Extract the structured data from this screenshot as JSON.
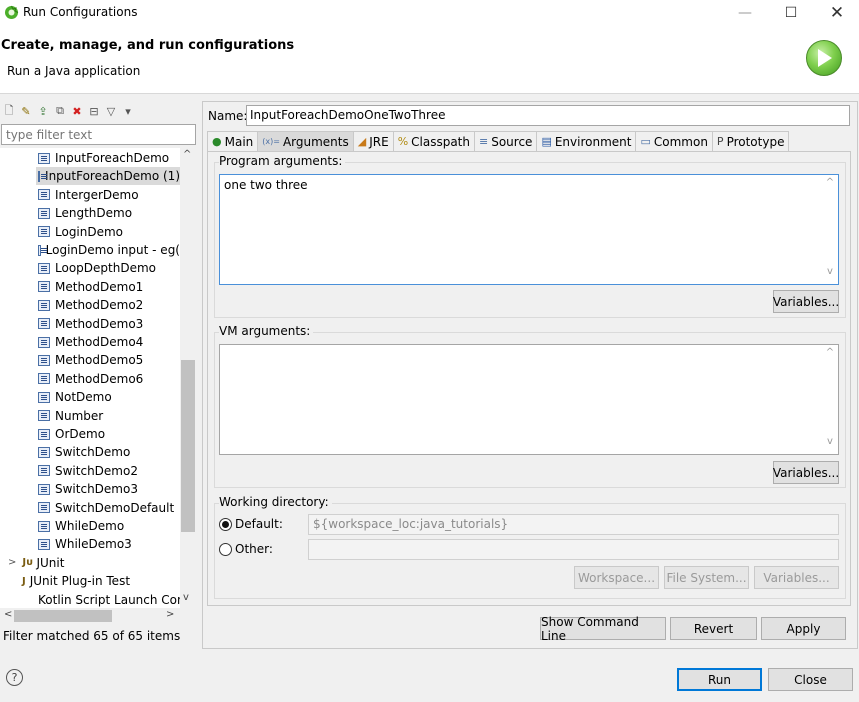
{
  "window": {
    "title": "Run Configurations",
    "minimize": "—",
    "maximize": "☐",
    "close": "✕"
  },
  "banner": {
    "title": "Create, manage, and run configurations",
    "subtitle": "Run a Java application"
  },
  "left": {
    "filter_placeholder": "type filter text",
    "tree_items": [
      "InputForeachDemo",
      "InputForeachDemo (1)",
      "IntergerDemo",
      "LengthDemo",
      "LoginDemo",
      "LoginDemo input - eg(",
      "LoopDepthDemo",
      "MethodDemo1",
      "MethodDemo2",
      "MethodDemo3",
      "MethodDemo4",
      "MethodDemo5",
      "MethodDemo6",
      "NotDemo",
      "Number",
      "OrDemo",
      "SwitchDemo",
      "SwitchDemo2",
      "SwitchDemo3",
      "SwitchDemoDefault",
      "WhileDemo",
      "WhileDemo3"
    ],
    "selected_index": 1,
    "category_junit": "JUnit",
    "category_junit_plugin": "JUnit Plug-in Test",
    "category_kotlin": "Kotlin Script Launch Conf",
    "junit_icon": "Jᴜ",
    "status": "Filter matched 65 of 65 items"
  },
  "right": {
    "name_label": "Name:",
    "name_value": "InputForeachDemoOneTwoThree",
    "tabs": [
      {
        "label": "Main",
        "icon": "main-icon"
      },
      {
        "label": "Arguments",
        "icon": "arguments-icon"
      },
      {
        "label": "JRE",
        "icon": "jre-icon"
      },
      {
        "label": "Classpath",
        "icon": "classpath-icon"
      },
      {
        "label": "Source",
        "icon": "source-icon"
      },
      {
        "label": "Environment",
        "icon": "environment-icon"
      },
      {
        "label": "Common",
        "icon": "common-icon"
      },
      {
        "label": "Prototype",
        "icon": "prototype-icon"
      }
    ],
    "active_tab": "Arguments",
    "program_args_label": "Program arguments:",
    "program_args_value": "one two three",
    "vm_args_label": "VM arguments:",
    "vm_args_value": "",
    "variables_label": "Variables...",
    "working_dir_label": "Working directory:",
    "default_label": "Default:",
    "default_value": "${workspace_loc:java_tutorials}",
    "other_label": "Other:",
    "workspace_btn": "Workspace...",
    "filesystem_btn": "File System...",
    "show_cmd_btn": "Show Command Line",
    "revert_btn": "Revert",
    "apply_btn": "Apply"
  },
  "footer": {
    "help": "?",
    "run_btn": "Run",
    "close_btn": "Close"
  }
}
